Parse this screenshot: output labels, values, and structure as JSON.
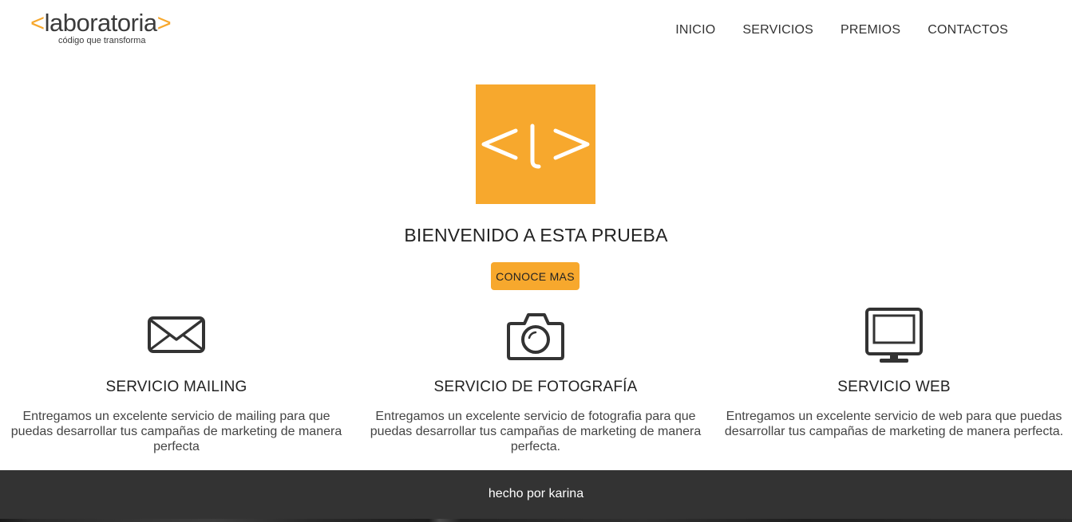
{
  "header": {
    "logo": {
      "bracket_open": "<",
      "word": "laboratoria",
      "bracket_close": ">",
      "tagline": "código que transforma"
    },
    "nav": [
      {
        "label": "INICIO"
      },
      {
        "label": "SERVICIOS"
      },
      {
        "label": "PREMIOS"
      },
      {
        "label": "CONTACTOS"
      }
    ]
  },
  "hero": {
    "logo_icon": "laboratoria-brackets-icon",
    "title": "BIENVENIDO A ESTA PRUEBA",
    "button_label": "CONOCE MAS"
  },
  "services": [
    {
      "icon": "envelope-icon",
      "title": "SERVICIO MAILING",
      "description": "Entregamos un excelente servicio de mailing para que puedas desarrollar tus campañas de marketing de manera perfecta"
    },
    {
      "icon": "camera-icon",
      "title": "SERVICIO DE FOTOGRAFÍA",
      "description": "Entregamos un excelente servicio de fotografia para que puedas desarrollar tus campañas de marketing de manera perfecta."
    },
    {
      "icon": "monitor-icon",
      "title": "SERVICIO WEB",
      "description": "Entregamos un excelente servicio de web para que puedas desarrollar tus campañas de marketing de manera perfecta."
    }
  ],
  "footer": {
    "credit": "hecho por karina"
  },
  "colors": {
    "accent": "#f7a82d",
    "text": "#333333",
    "footer_bg": "#333333"
  }
}
